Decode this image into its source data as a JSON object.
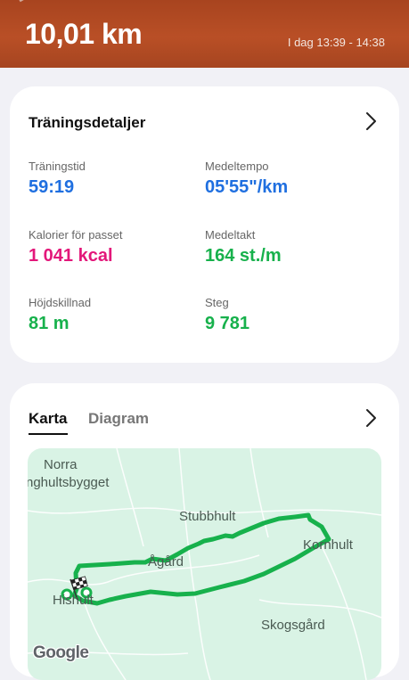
{
  "header": {
    "distance": "10,01 km",
    "time_range": "I dag 13:39 - 14:38"
  },
  "details": {
    "title": "Träningsdetaljer",
    "stats": [
      {
        "label": "Träningstid",
        "value": "59:19",
        "color": "#1f6fe0"
      },
      {
        "label": "Medeltempo",
        "value": "05'55\"/km",
        "color": "#1f6fe0"
      },
      {
        "label": "Kalorier för passet",
        "value": "1 041 kcal",
        "color": "#e3177a"
      },
      {
        "label": "Medeltakt",
        "value": "164 st./m",
        "color": "#17b14c"
      },
      {
        "label": "Höjdskillnad",
        "value": "81 m",
        "color": "#17b14c"
      },
      {
        "label": "Steg",
        "value": "9 781",
        "color": "#17b14c"
      }
    ]
  },
  "map_card": {
    "tabs": [
      "Karta",
      "Diagram"
    ],
    "active_tab": "Karta",
    "places": [
      "Norra",
      "nghultsbygget",
      "Stubbhult",
      "Kornhult",
      "Ågård",
      "Hishult",
      "Skogsgård"
    ],
    "attribution": "Google",
    "route_color": "#17b14c",
    "map_background": "#d9f3e5"
  },
  "colors": {
    "hero_bg": "#b04a22",
    "page_bg": "#f1f1f6"
  }
}
